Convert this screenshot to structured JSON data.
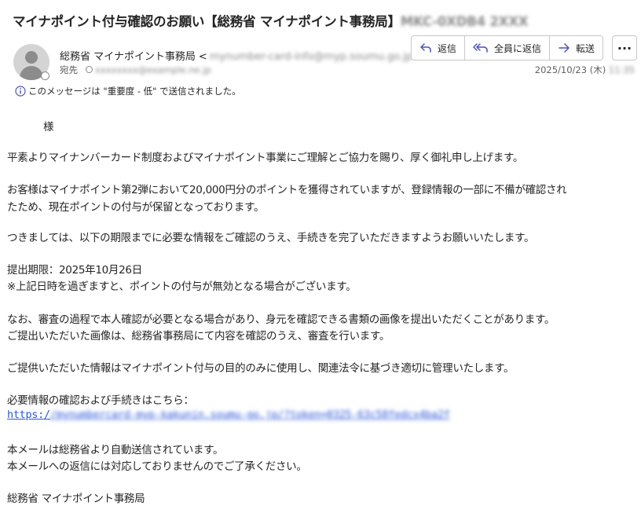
{
  "subject": {
    "text": "マイナポイント付与確認のお願い【総務省 マイナポイント事務局】",
    "code": "MKC-0XDB4 2XXX"
  },
  "sender": {
    "name": "総務省 マイナポイント事務局",
    "email": "mynumber-card-info@myp.soumu.go.jp"
  },
  "recipient": {
    "label": "宛先",
    "email": "xxxxxxxx@example.ne.jp"
  },
  "actions": {
    "reply": "返信",
    "reply_all": "全員に返信",
    "forward": "転送"
  },
  "date": {
    "text": "2025/10/23 (木)",
    "time": "11:35"
  },
  "importance_note": "このメッセージは \"重要度 - 低\" で送信されました。",
  "body": {
    "greeting": "様",
    "p1": "平素よりマイナンバーカード制度およびマイナポイント事業にご理解とご協力を賜り、厚く御礼申し上げます。",
    "p2a": "お客様はマイナポイント第2弾において20,000円分のポイントを獲得されていますが、登録情報の一部に不備が確認され",
    "p2b": "たため、現在ポイントの付与が保留となっております。",
    "p3": "つきましては、以下の期限までに必要な情報をご確認のうえ、手続きを完了いただきますようお願いいたします。",
    "deadline": "提出期限：2025年10月26日",
    "deadline_note": "※上記日時を過ぎますと、ポイントの付与が無効となる場合がございます。",
    "p5a": "なお、審査の過程で本人確認が必要となる場合があり、身元を確認できる書類の画像を提出いただくことがあります。",
    "p5b": "ご提出いただいた画像は、総務省事務局にて内容を確認のうえ、審査を行います。",
    "p6": "ご提供いただいた情報はマイナポイント付与の目的のみに使用し、関連法令に基づき適切に管理いたします。",
    "link_intro": "必要情報の確認および手続きはこちら：",
    "link_scheme": "https:/",
    "link_rest": "/mynumbercard-myp-kakunin.soumu-go.jp/?token=0325-63c58fedcx4ba2f",
    "auto1": "本メールは総務省より自動送信されています。",
    "auto2": "本メールへの返信には対応しておりませんのでご了承ください。",
    "signature": "総務省 マイナポイント事務局"
  },
  "colors": {
    "link": "#2b57d9",
    "accent": "#4f52b2",
    "text": "#242424"
  }
}
